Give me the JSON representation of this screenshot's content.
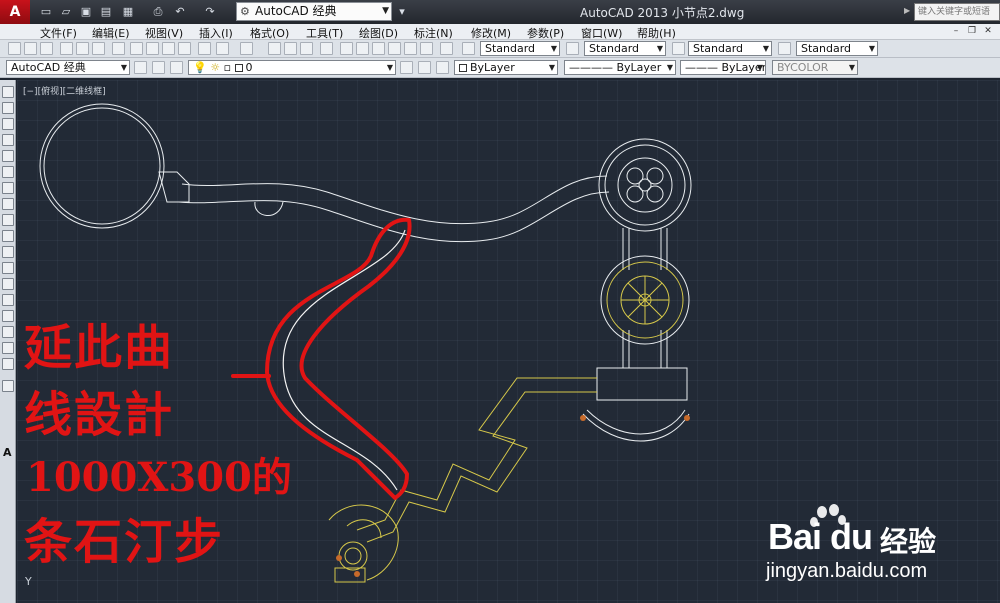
{
  "titlebar": {
    "workspace": "AutoCAD 经典",
    "app_title": "AutoCAD 2013    小节点2.dwg",
    "search_placeholder": "键入关键字或短语"
  },
  "menu": {
    "items": [
      "文件(F)",
      "编辑(E)",
      "视图(V)",
      "插入(I)",
      "格式(O)",
      "工具(T)",
      "绘图(D)",
      "标注(N)",
      "修改(M)",
      "参数(P)",
      "窗口(W)",
      "帮助(H)"
    ]
  },
  "toolbar": {
    "text_style": "Standard",
    "dim_style": "Standard",
    "table_style": "Standard",
    "multileader_style": "Standard",
    "workspace_combo": "AutoCAD 经典",
    "layer": "0",
    "color": "ByLayer",
    "linetype": "ByLayer",
    "lineweight": "ByLayer",
    "plotstyle": "BYCOLOR"
  },
  "viewport": {
    "label": "[−][俯视][二维线框]",
    "ucs_axis": "Y"
  },
  "annotation": {
    "line1": "延此曲",
    "line2": "线設計",
    "line3": "1000X300的",
    "line4": "条石汀步"
  },
  "watermark": {
    "brand": "Bai du",
    "cn": "经验",
    "url": "jingyan.baidu.com"
  },
  "colors": {
    "canvas": "#222a36",
    "cad_white": "#e8ecef",
    "cad_yellow": "#d6c84a",
    "cad_orange": "#c76a2a",
    "annotation_red": "#e11414"
  }
}
